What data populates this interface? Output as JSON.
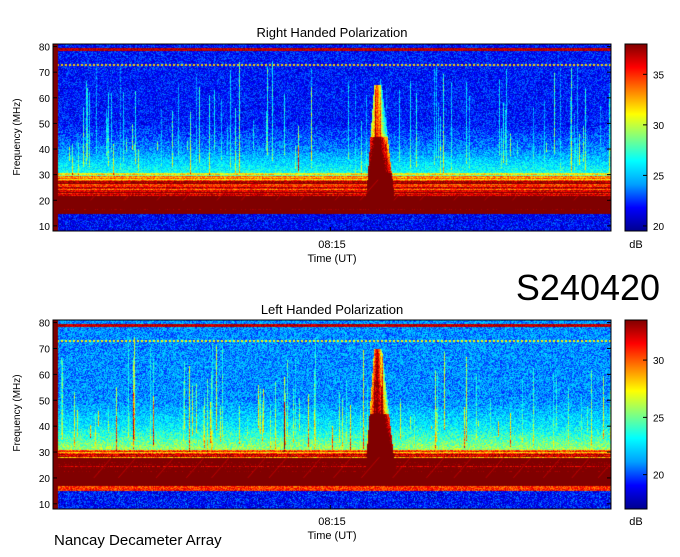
{
  "page": {
    "station_id": "S240420",
    "footer": "Nancay Decameter Array"
  },
  "chart_data": [
    {
      "type": "heatmap",
      "title": "Right Handed Polarization",
      "xlabel": "Time (UT)",
      "ylabel": "Frequency (MHz)",
      "x_ticks": [
        "08:15"
      ],
      "y_ticks": [
        10,
        20,
        30,
        40,
        50,
        60,
        70,
        80
      ],
      "ylim": [
        8,
        81
      ],
      "colorbar": {
        "label": "dB",
        "ticks": [
          20,
          25,
          30,
          35
        ],
        "range": [
          19.5,
          38
        ]
      },
      "colormap": [
        "#00008f",
        "#0000ff",
        "#00a0ff",
        "#00ffff",
        "#80ff80",
        "#ffff00",
        "#ff8000",
        "#ff0000",
        "#800000"
      ],
      "features": {
        "background_level_db": 22,
        "low_band_saturated_mhz": [
          15,
          31
        ],
        "burst": {
          "time_fraction": 0.58,
          "freq_mhz": [
            17,
            65
          ],
          "peak_db": 38
        },
        "tx_line_mhz": 79,
        "dashed_line_mhz": 73
      },
      "grid": false
    },
    {
      "type": "heatmap",
      "title": "Left Handed Polarization",
      "xlabel": "Time (UT)",
      "ylabel": "Frequency (MHz)",
      "x_ticks": [
        "08:15"
      ],
      "y_ticks": [
        10,
        20,
        30,
        40,
        50,
        60,
        70,
        80
      ],
      "ylim": [
        8,
        81
      ],
      "colorbar": {
        "label": "dB",
        "ticks": [
          20,
          25,
          30
        ],
        "range": [
          17,
          33.5
        ]
      },
      "colormap": [
        "#00008f",
        "#0000ff",
        "#00a0ff",
        "#00ffff",
        "#80ff80",
        "#ffff00",
        "#ff8000",
        "#ff0000",
        "#800000"
      ],
      "features": {
        "background_level_db": 21,
        "low_band_saturated_mhz": [
          17,
          31
        ],
        "burst": {
          "time_fraction": 0.58,
          "freq_mhz": [
            17,
            70
          ],
          "peak_db": 33.5
        },
        "tx_line_mhz": 79,
        "dashed_line_mhz": 73
      },
      "grid": false
    }
  ]
}
